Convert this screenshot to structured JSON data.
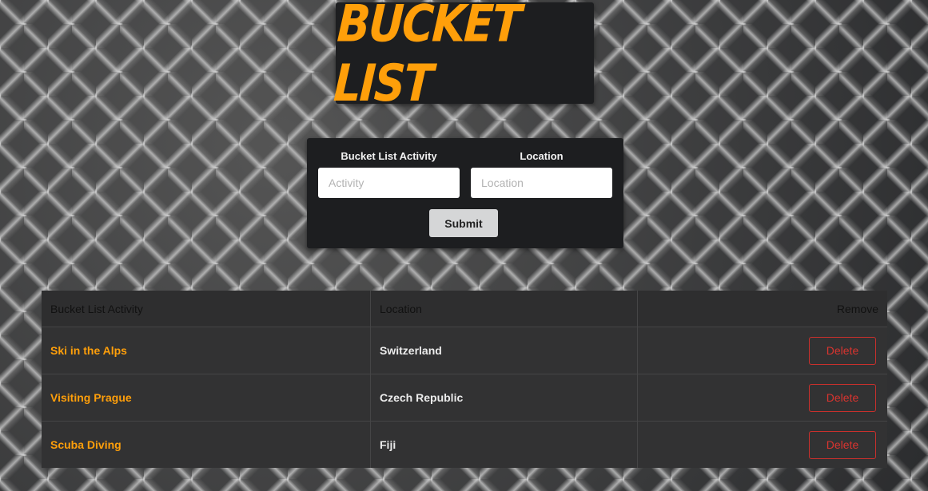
{
  "header": {
    "title": "Bucket List"
  },
  "form": {
    "activity_label": "Bucket List Activity",
    "location_label": "Location",
    "activity_placeholder": "Activity",
    "location_placeholder": "Location",
    "submit_label": "Submit"
  },
  "table": {
    "headers": {
      "activity": "Bucket List Activity",
      "location": "Location",
      "remove": "Remove"
    },
    "rows": [
      {
        "activity": "Ski in the Alps",
        "location": "Switzerland",
        "action": "Delete"
      },
      {
        "activity": "Visiting Prague",
        "location": "Czech Republic",
        "action": "Delete"
      },
      {
        "activity": "Scuba Diving",
        "location": "Fiji",
        "action": "Delete"
      }
    ]
  },
  "colors": {
    "accent": "#ff9f0a",
    "panel": "#1d1e20",
    "table_bg": "#323233",
    "delete": "#d9342f"
  }
}
